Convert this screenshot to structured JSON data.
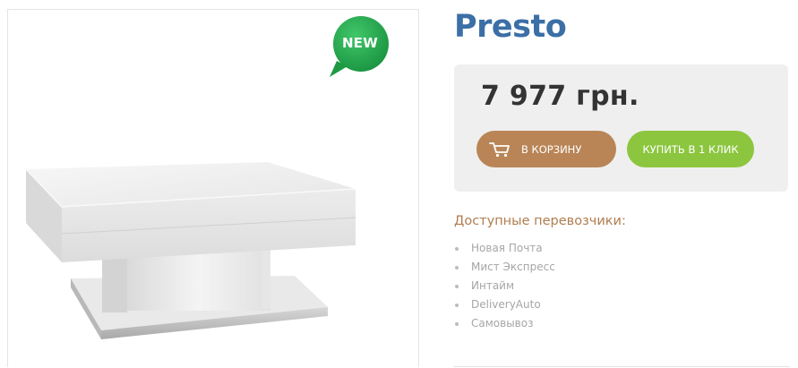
{
  "product": {
    "title": "Presto",
    "badge": "NEW",
    "image": {
      "alt": "Presto coffee table",
      "icon": "product-photo"
    }
  },
  "pricing": {
    "price": "7 977 грн."
  },
  "actions": {
    "cart_label": "в корзину",
    "cart_icon": "cart-icon",
    "buy_label": "купить в 1 клик"
  },
  "carriers": {
    "title": "Доступные перевозчики:",
    "items": [
      {
        "label": "Новая Почта"
      },
      {
        "label": "Мист Экспресс"
      },
      {
        "label": "Интайм"
      },
      {
        "label": "DeliveryAuto"
      },
      {
        "label": "Самовывоз"
      }
    ]
  },
  "colors": {
    "title": "#3b6fa6",
    "cart_button": "#b98556",
    "buy_button": "#8cc63f",
    "badge": "#22a84a",
    "carriers_title": "#b07d4f"
  }
}
